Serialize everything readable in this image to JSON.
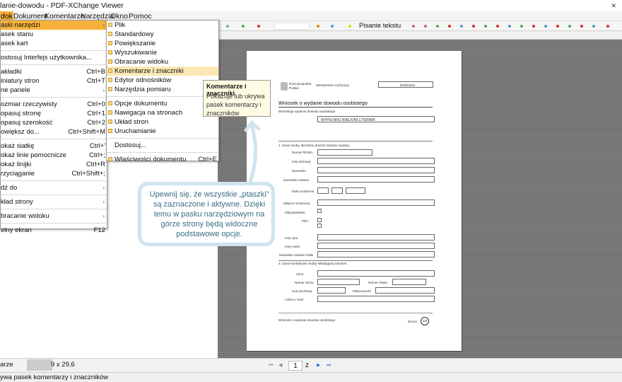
{
  "window": {
    "title": "lanie-dowodu - PDF-XChange Viewer",
    "close_glyph": "✕"
  },
  "menubar": [
    "dok",
    "Dokument",
    "Komentarze",
    "Narzędzia",
    "Okno",
    "Pomoc"
  ],
  "colors": {
    "highlight": "#f6b13a",
    "callout_border": "#d0e4ee",
    "callout_text": "#3a6e84"
  },
  "view_menu": [
    {
      "label": "aski narzędzi",
      "shortcut": "",
      "arrow": true,
      "state": "highlight"
    },
    {
      "label": "asek stanu",
      "shortcut": ""
    },
    {
      "label": "asek kart",
      "shortcut": ""
    },
    {
      "sep": true
    },
    {
      "label": "ostosuj Interfejs użytkownika...",
      "shortcut": ""
    },
    {
      "sep": true
    },
    {
      "label": "akładki",
      "shortcut": "Ctrl+B"
    },
    {
      "label": "iniatury stron",
      "shortcut": "Ctrl+T"
    },
    {
      "label": "ne panele",
      "shortcut": "",
      "arrow": true
    },
    {
      "sep": true
    },
    {
      "label": "ozmiar rzeczywisty",
      "shortcut": "Ctrl+0"
    },
    {
      "label": "opasuj stronę",
      "shortcut": "Ctrl+1"
    },
    {
      "label": "opasuj szerokość",
      "shortcut": "Ctrl+2"
    },
    {
      "label": "owiększ do...",
      "shortcut": "Ctrl+Shift+M"
    },
    {
      "sep": true
    },
    {
      "label": "okaż siatkę",
      "shortcut": "Ctrl+'"
    },
    {
      "label": "okaż linie pomocnicze",
      "shortcut": "Ctrl+;"
    },
    {
      "label": "okaż linijki",
      "shortcut": "Ctrl+R"
    },
    {
      "label": "rzyciąganie",
      "shortcut": "Ctrl+Shift+;"
    },
    {
      "sep": true
    },
    {
      "label": "dź do",
      "shortcut": "",
      "arrow": true
    },
    {
      "sep": true
    },
    {
      "label": "kład strony",
      "shortcut": "",
      "arrow": true
    },
    {
      "sep": true
    },
    {
      "label": "bracanie widoku",
      "shortcut": "",
      "arrow": true
    },
    {
      "sep": true
    },
    {
      "label": "ełny ekran",
      "shortcut": "F12"
    }
  ],
  "toolbars_menu": [
    {
      "label": "Plik",
      "check": true
    },
    {
      "label": "Standardowy",
      "check": true
    },
    {
      "label": "Powiększanie",
      "check": true
    },
    {
      "label": "Wyszukiwanie",
      "check": true
    },
    {
      "label": "Obracanie widoku",
      "check": true
    },
    {
      "label": "Komentarze i znaczniki",
      "check": true,
      "state": "highlight"
    },
    {
      "label": "Edytor odnośników",
      "check": true
    },
    {
      "label": "Narzędzia pomiaru",
      "check": true
    },
    {
      "sep": true
    },
    {
      "label": "Opcje dokumentu",
      "check": true
    },
    {
      "label": "Nawigacja na stronach",
      "check": true
    },
    {
      "label": "Układ stron",
      "check": true
    },
    {
      "label": "Uruchamianie",
      "check": true
    },
    {
      "sep": true
    },
    {
      "label": "Dostosuj...",
      "check": false
    },
    {
      "sep": true
    },
    {
      "label": "Właściwości dokumentu",
      "check": true,
      "shortcut": "Ctrl+E"
    }
  ],
  "tooltip": {
    "title": "Komentarze i znaczniki",
    "desc": "Pokazuje lub ukrywa pasek komentarzy i znaczników"
  },
  "callout": {
    "text": "Upewnij się, że wszystkie „ptaszki” są zaznaczone i aktywne. Dzięki temu w pasku narzędziowym na górze strony będą widoczne podstawowe opcje."
  },
  "toolbar": {
    "typewriter_label": "Pisanie tekstu"
  },
  "document": {
    "org": "Rzeczpospolita Polska",
    "dept": "Ministerstwo Cyfryzacji",
    "code": "DOWWN1",
    "heading": "Wniosek o wydanie dowodu osobistego",
    "fill_hint": "WYPEŁNIAJ WIELKIMI LITERAMI",
    "footer_left": "Wniosek o wydanie dowodu osobistego",
    "footer_right": "strona",
    "footer_page": "1/3",
    "fields": [
      "Numer PESEL",
      "Imię (imiona)",
      "Nazwisko",
      "Nazwisko rodowe",
      "Data urodzenia",
      "Miejsce urodzenia",
      "Obywatelstwo",
      "Płeć",
      "Imię ojca",
      "Imię matki",
      "Nazwisko rodowe matki",
      "Ulica",
      "Numer domu",
      "Kod pocztowy",
      "Adres e-mail",
      "Numer lokalu",
      "Miejscowość"
    ],
    "sections": [
      "Wnioskuję wydanie dowodu osobistego",
      "1. Dane osoby, dla której dowód zostanie wydany",
      "2. Dane kontaktowe osoby składającej wniosek"
    ]
  },
  "paging": {
    "current": "1",
    "total": "z 2",
    "prev": "◀",
    "next": "▶",
    "first": "⏮",
    "last": "⏭"
  },
  "bottom_left": {
    "size_label": "arze",
    "size_value": "9 x 29,6"
  },
  "status": {
    "text": "ywa pasek komentarzy i znaczników"
  }
}
